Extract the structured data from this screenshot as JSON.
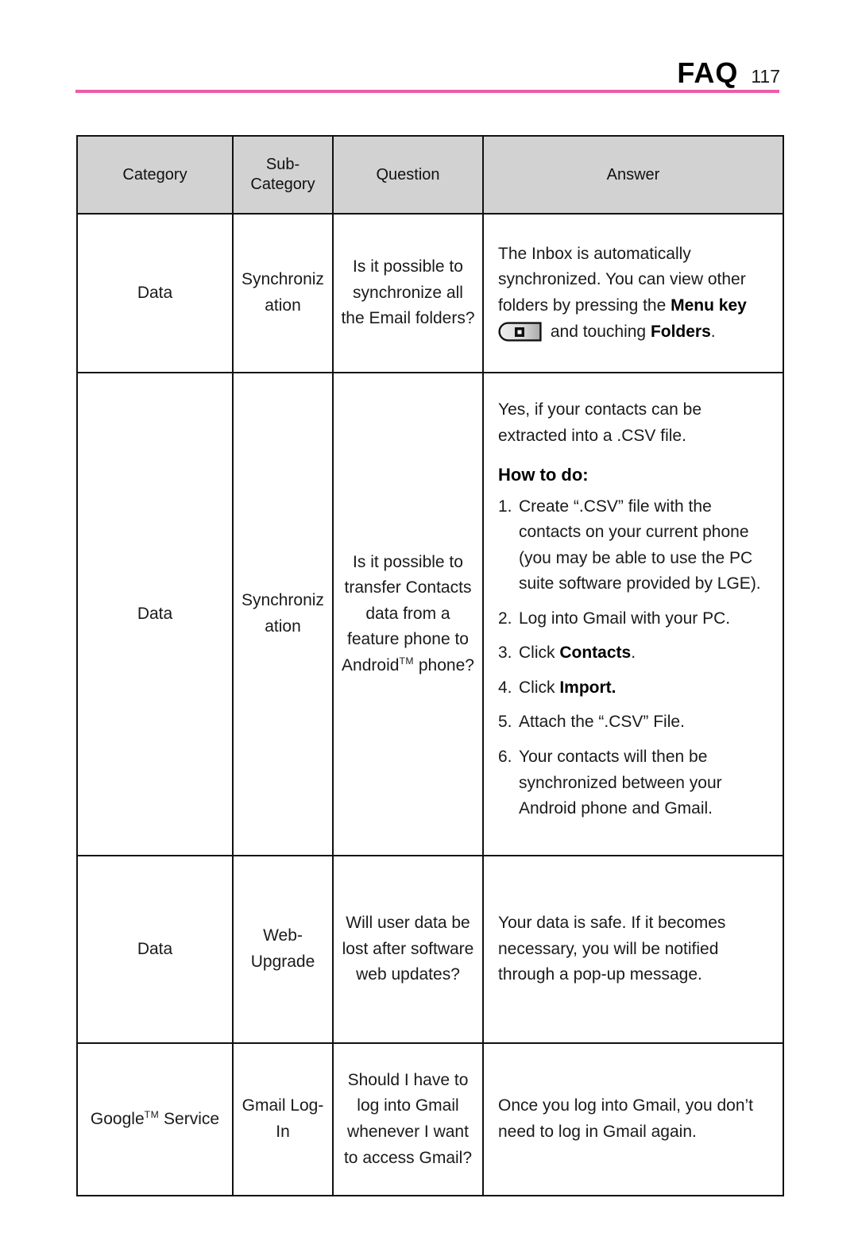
{
  "header": {
    "title": "FAQ",
    "page_number": "117",
    "rule_color": "#ec5ca8"
  },
  "table": {
    "header_background": "#d2d2d2",
    "border_color": "#111111",
    "columns": [
      {
        "key": "category",
        "label": "Category"
      },
      {
        "key": "sub_category",
        "label": "Sub-\nCategory"
      },
      {
        "key": "question",
        "label": "Question"
      },
      {
        "key": "answer",
        "label": "Answer"
      }
    ],
    "column_labels": {
      "category": "Category",
      "sub_category_line1": "Sub-",
      "sub_category_line2": "Category",
      "question": "Question",
      "answer": "Answer"
    },
    "rows": [
      {
        "category": "Data",
        "sub_category_line1": "Synchroniz",
        "sub_category_line2": "ation",
        "question": "Is it possible to synchronize all the Email folders?",
        "answer": {
          "text_part1": "The Inbox is automatically synchronized. You can view other folders by pressing the ",
          "bold1": "Menu key",
          "icon": "menu-key-icon",
          "text_part2": " and touching ",
          "bold2": "Folders",
          "text_part3": "."
        }
      },
      {
        "category": "Data",
        "sub_category_line1": "Synchroniz",
        "sub_category_line2": "ation",
        "question_prefix": "Is it possible to transfer Contacts data from a feature phone to Android",
        "question_tm": "TM",
        "question_suffix": " phone?",
        "answer": {
          "intro": "Yes, if your contacts can be extracted into a .CSV file.",
          "howto_label": "How to do:",
          "steps": [
            {
              "num": "1.",
              "text": "Create “.CSV” file with the contacts on your current phone (you may be able to use the PC suite software provided by LGE)."
            },
            {
              "num": "2.",
              "text": "Log into Gmail with your PC."
            },
            {
              "num": "3.",
              "text_before": "Click ",
              "bold": "Contacts",
              "text_after": "."
            },
            {
              "num": "4.",
              "text_before": "Click ",
              "bold": "Import.",
              "text_after": ""
            },
            {
              "num": "5.",
              "text": "Attach the “.CSV” File."
            },
            {
              "num": "6.",
              "text": "Your contacts will then be synchronized between your Android phone and Gmail."
            }
          ]
        }
      },
      {
        "category": "Data",
        "sub_category_line1": "Web-",
        "sub_category_line2": "Upgrade",
        "question": "Will user data be lost after software web updates?",
        "answer": {
          "text": "Your data is safe. If it becomes necessary, you will be notified through a pop-up message."
        }
      },
      {
        "category_prefix": "Google",
        "category_tm": "TM",
        "category_suffix": " Service",
        "sub_category_line1": "Gmail Log-",
        "sub_category_line2": "In",
        "question": "Should I have to log into Gmail whenever I want to access Gmail?",
        "answer": {
          "text": "Once you log into Gmail, you don’t need to log in Gmail again."
        }
      }
    ]
  }
}
